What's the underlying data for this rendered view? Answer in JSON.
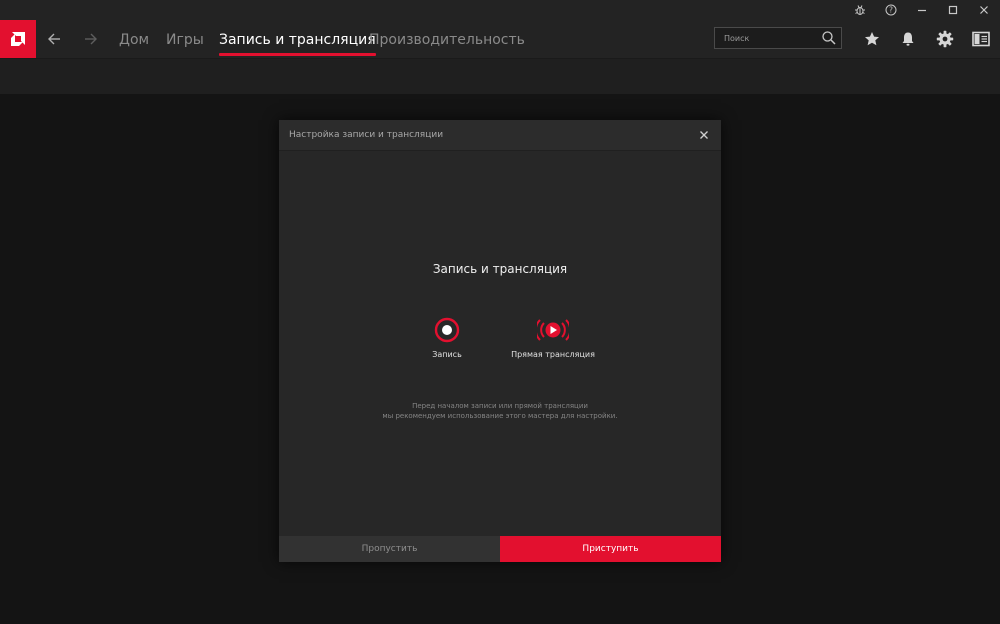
{
  "titlebar": {
    "controls": [
      {
        "name": "bug-report-icon"
      },
      {
        "name": "help-icon"
      },
      {
        "name": "minimize-icon"
      },
      {
        "name": "maximize-icon"
      },
      {
        "name": "close-icon"
      }
    ]
  },
  "nav": {
    "logo_icon": "amd-logo-icon",
    "tabs": [
      {
        "label": "Дом",
        "active": false
      },
      {
        "label": "Игры",
        "active": false
      },
      {
        "label": "Запись и трансляция",
        "active": true
      },
      {
        "label": "Производительность",
        "active": false
      }
    ],
    "search_placeholder": "Поиск",
    "icons": [
      "star-icon",
      "bell-icon",
      "gear-icon",
      "layout-panel-icon"
    ]
  },
  "dialog": {
    "title": "Настройка записи и трансляции",
    "heading": "Запись и трансляция",
    "options": [
      {
        "label": "Запись",
        "icon": "record-icon"
      },
      {
        "label": "Прямая трансляция",
        "icon": "live-stream-icon"
      }
    ],
    "hint_line1": "Перед началом записи или прямой трансляции",
    "hint_line2": "мы рекомендуем использование этого мастера для настройки.",
    "skip_label": "Пропустить",
    "start_label": "Приступить"
  },
  "colors": {
    "accent": "#e3102f",
    "background": "#141414",
    "panel": "#272727",
    "header": "#232323"
  }
}
